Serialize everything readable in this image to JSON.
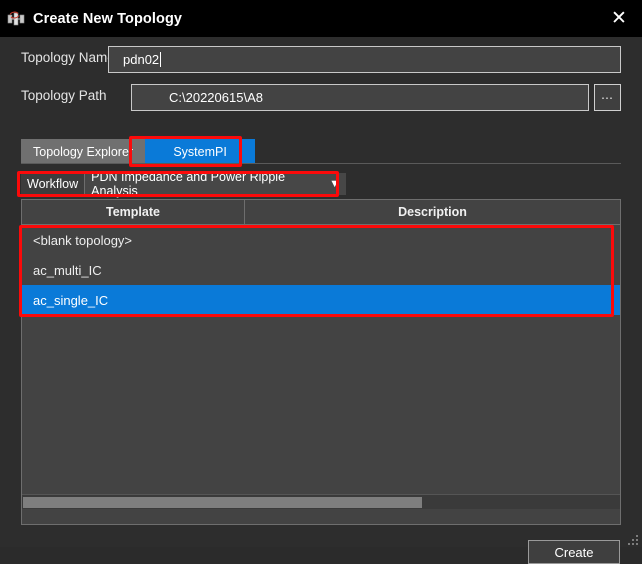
{
  "window": {
    "title": "Create New Topology",
    "icon": "topology-icon",
    "close_label": "✕",
    "accent_color": "#0a7ad8",
    "annotation_color": "#fb0a0a"
  },
  "form": {
    "name_label": "Topology Name",
    "name_value": "pdn02",
    "path_label": "Topology Path",
    "path_value": "C:\\20220615\\A8",
    "browse_label": "⋯"
  },
  "tabs": [
    {
      "label": "Topology Explorer",
      "active": false
    },
    {
      "label": "SystemPI",
      "active": true
    }
  ],
  "workflow": {
    "label": "Workflow",
    "selected": "PDN Impedance and Power Ripple Analysis",
    "caret": "▼"
  },
  "table": {
    "columns": [
      "Template",
      "Description"
    ],
    "rows": [
      {
        "template": "<blank topology>",
        "description": "",
        "selected": false
      },
      {
        "template": "ac_multi_IC",
        "description": "",
        "selected": false
      },
      {
        "template": "ac_single_IC",
        "description": "",
        "selected": true
      }
    ]
  },
  "footer": {
    "create_label": "Create"
  }
}
